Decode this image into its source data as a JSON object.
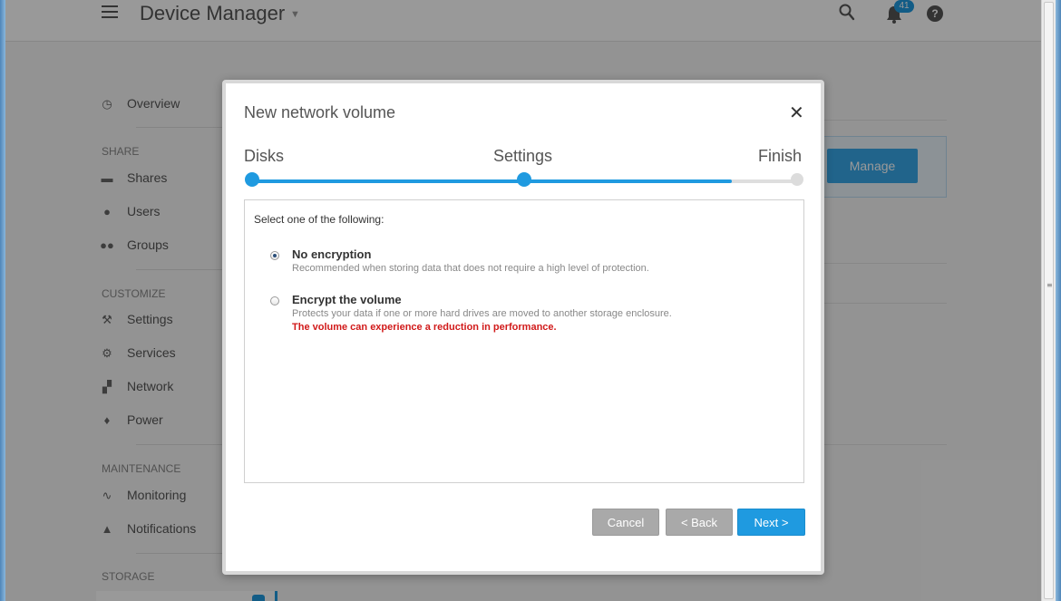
{
  "header": {
    "title": "Device Manager",
    "notification_count": "41",
    "help_label": "?"
  },
  "sidebar": {
    "overview": "Overview",
    "sections": [
      {
        "label": "SHARE",
        "items": [
          "Shares",
          "Users",
          "Groups"
        ]
      },
      {
        "label": "CUSTOMIZE",
        "items": [
          "Settings",
          "Services",
          "Network",
          "Power"
        ]
      },
      {
        "label": "MAINTENANCE",
        "items": [
          "Monitoring",
          "Notifications"
        ]
      },
      {
        "label": "STORAGE",
        "items": []
      }
    ]
  },
  "main": {
    "manage_button": "Manage"
  },
  "modal": {
    "title": "New network volume",
    "close": "✕",
    "steps": [
      "Disks",
      "Settings",
      "Finish"
    ],
    "progress": 0.88,
    "prompt": "Select one of the following:",
    "options": [
      {
        "title": "No encryption",
        "description": "Recommended when storing data that does not require a high level of protection.",
        "selected": true
      },
      {
        "title": "Encrypt the volume",
        "description": "Protects your data if one or more hard drives are moved to another storage enclosure.",
        "warning": "The volume can experience a reduction in performance.",
        "selected": false
      }
    ],
    "buttons": {
      "cancel": "Cancel",
      "back": "< Back",
      "next": "Next >"
    }
  },
  "colors": {
    "accent": "#1f9ae0",
    "warning": "#d11a1a"
  }
}
